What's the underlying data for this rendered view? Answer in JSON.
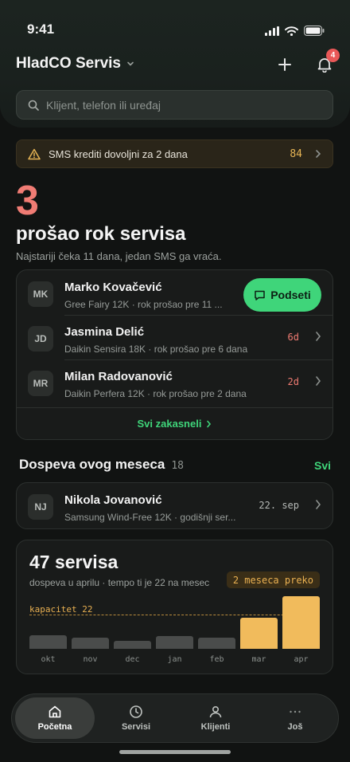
{
  "status_bar": {
    "time": "9:41"
  },
  "header": {
    "app_title": "HladCO Servis",
    "notification_count": "4",
    "search_placeholder": "Klijent, telefon ili uređaj"
  },
  "alert": {
    "text": "SMS krediti dovoljni za 2 dana",
    "count": "84"
  },
  "overdue": {
    "count": "3",
    "title": "prošao rok servisa",
    "subtitle": "Najstariji čeka 11 dana, jedan SMS ga vraća.",
    "items": [
      {
        "initials": "MK",
        "name": "Marko Kovačević",
        "detail": "Gree Fairy 12K · rok prošao pre 11 ...",
        "action": "Podseti"
      },
      {
        "initials": "JD",
        "name": "Jasmina Delić",
        "detail": "Daikin Sensira 18K · rok prošao pre 6 dana",
        "days": "6d"
      },
      {
        "initials": "MR",
        "name": "Milan Radovanović",
        "detail": "Daikin Perfera 12K · rok prošao pre 2 dana",
        "days": "2d"
      }
    ],
    "see_all": "Svi zakasneli"
  },
  "due_this_month": {
    "title": "Dospeva ovog meseca",
    "count": "18",
    "link": "Svi",
    "items": [
      {
        "initials": "NJ",
        "name": "Nikola Jovanović",
        "detail": "Samsung Wind-Free 12K · godišnji ser...",
        "date": "22. sep"
      }
    ]
  },
  "stats": {
    "title": "47 servisa",
    "subtitle": "dospeva u aprilu · tempo ti je 22 na mesec",
    "badge": "2 meseca preko",
    "capacity_label": "kapacitet 22"
  },
  "chart_data": {
    "type": "bar",
    "categories": [
      "okt",
      "nov",
      "dec",
      "jan",
      "feb",
      "mar",
      "apr"
    ],
    "values": [
      9,
      7,
      5,
      8,
      7,
      20,
      34
    ],
    "capacity": 22,
    "over_capacity": [
      false,
      false,
      false,
      false,
      false,
      true,
      true
    ],
    "colors": {
      "normal": "#4a4c4b",
      "over": "#f1bb5c"
    }
  },
  "tabbar": {
    "tabs": [
      {
        "label": "Početna",
        "icon": "home-icon"
      },
      {
        "label": "Servisi",
        "icon": "clock-icon"
      },
      {
        "label": "Klijenti",
        "icon": "user-icon"
      },
      {
        "label": "Još",
        "icon": "more-icon"
      }
    ]
  }
}
